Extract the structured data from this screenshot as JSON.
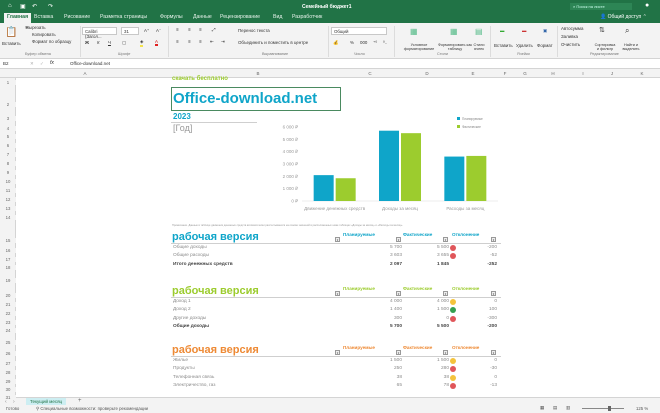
{
  "app": {
    "title": "Семейный бюджет1",
    "search_placeholder": "Поиск на листе",
    "share": "Общий доступ"
  },
  "colors": {
    "excel_green": "#217346",
    "blue": "#0fa5c9",
    "green": "#9ccc2e",
    "orange": "#ee8a35",
    "red_dot": "#e0565a",
    "yellow_dot": "#f4c33c",
    "green_dot": "#35a050"
  },
  "ribbon_tabs": [
    "Главная",
    "Вставка",
    "Рисование",
    "Разметка страницы",
    "Формулы",
    "Данные",
    "Рецензирование",
    "Вид",
    "Разработчик"
  ],
  "ribbon": {
    "paste": "Вставить",
    "cut": "Вырезать",
    "copy": "Копировать",
    "format_painter": "Формат по образцу",
    "clipboard_group": "Буфер обмена",
    "font_name": "Calibri (Загол...",
    "font_size": "31",
    "font_group": "Шрифт",
    "bold": "Ж",
    "italic": "К",
    "underline": "Ч",
    "wrap_text": "Перенос текста",
    "merge_center": "Объединить и поместить в центре",
    "alignment_group": "Выравнивание",
    "number_format": "Общий",
    "number_group": "Число",
    "percent": "%",
    "thousands": "000",
    "conditional": "Условное форматирование",
    "format_table": "Форматировать как таблицу",
    "cell_styles": "Стили ячеек",
    "styles_group": "Стили",
    "insert": "Вставить",
    "delete": "Удалить",
    "format": "Формат",
    "cells_group": "Ячейки",
    "autosum": "Автосумма",
    "fill": "Заливка",
    "clear": "Очистить",
    "sort_filter": "Сортировка и фильтр",
    "find_select": "Найти и выделить",
    "editing_group": "Редактирование"
  },
  "formula_bar": {
    "cell_ref": "B2",
    "fx": "fx",
    "value": "Office-download.net"
  },
  "columns": [
    "A",
    "B",
    "C",
    "D",
    "E",
    "F",
    "G",
    "H",
    "I",
    "J",
    "K"
  ],
  "rows": [
    "1",
    "2",
    "3",
    "4",
    "5",
    "6",
    "7",
    "8",
    "9",
    "10",
    "11",
    "12",
    "13",
    "14",
    "15",
    "16",
    "17",
    "18",
    "19",
    "20",
    "21",
    "22",
    "23",
    "24",
    "25",
    "26",
    "27",
    "28",
    "29",
    "30",
    "31"
  ],
  "sheet": {
    "download_free": "скачать бесплатно",
    "site": "Office-download.net",
    "year": "2023",
    "year_placeholder": "[Год]",
    "note": "Примечание. Данные в таблице движения денежных средств автоматически рассчитываются на основе значений в расположенных ниже таблицах «Доходы за месяц» и «Расходы за месяц»."
  },
  "chart_data": {
    "type": "bar",
    "categories": [
      "Движение денежных средств",
      "Доходы за месяц",
      "Расходы за месяц"
    ],
    "series": [
      {
        "name": "Планируемые",
        "values": [
          2097,
          5700,
          3603
        ],
        "color": "#0fa5c9"
      },
      {
        "name": "Фактические",
        "values": [
          1845,
          5500,
          3655
        ],
        "color": "#9ccc2e"
      }
    ],
    "yticks": [
      "0 ₽",
      "1 000 ₽",
      "2 000 ₽",
      "3 000 ₽",
      "4 000 ₽",
      "5 000 ₽",
      "6 000 ₽"
    ],
    "ylim": [
      0,
      6000
    ],
    "legend": "top-right",
    "grid": false
  },
  "tables": [
    {
      "title": "рабочая версия",
      "color": "#0fa5c9",
      "headers": [
        "Планируемые",
        "Фактические",
        "Отклонение"
      ],
      "rows": [
        {
          "label": "Общие доходы",
          "plan": "5 700",
          "fact": "5 500",
          "diff": "-200",
          "dot": "red"
        },
        {
          "label": "Общие расходы",
          "plan": "3 603",
          "fact": "3 655",
          "diff": "-52",
          "dot": "red"
        }
      ],
      "total": {
        "label": "Итого денежных средств",
        "plan": "2 097",
        "fact": "1 845",
        "diff": "-252"
      }
    },
    {
      "title": "рабочая версия",
      "color": "#9ccc2e",
      "headers": [
        "Планируемые",
        "Фактические",
        "Отклонение"
      ],
      "rows": [
        {
          "label": "Доход 1",
          "plan": "4 000",
          "fact": "4 000",
          "diff": "0",
          "dot": "yellow"
        },
        {
          "label": "Доход 2",
          "plan": "1 400",
          "fact": "1 500",
          "diff": "100",
          "dot": "green"
        },
        {
          "label": "Другие доходы",
          "plan": "300",
          "fact": "0",
          "diff": "-300",
          "dot": "red"
        }
      ],
      "total": {
        "label": "Общие доходы",
        "plan": "5 700",
        "fact": "5 500",
        "diff": "-200"
      }
    },
    {
      "title": "рабочая версия",
      "color": "#ee8a35",
      "headers": [
        "Планируемые",
        "Фактические",
        "Отклонение"
      ],
      "rows": [
        {
          "label": "Жилье",
          "plan": "1 500",
          "fact": "1 500",
          "diff": "0",
          "dot": "yellow"
        },
        {
          "label": "Продукты",
          "plan": "250",
          "fact": "280",
          "diff": "-30",
          "dot": "red"
        },
        {
          "label": "Телефонная связь",
          "plan": "38",
          "fact": "38",
          "diff": "0",
          "dot": "yellow"
        },
        {
          "label": "Электричество, газ",
          "plan": "65",
          "fact": "78",
          "diff": "-13",
          "dot": "red"
        }
      ]
    }
  ],
  "sheet_tabs": [
    "Текущий месяц"
  ],
  "status": {
    "ready": "Готово",
    "accessibility": "Специальные возможности: проверьте рекомендации",
    "zoom": "125 %"
  }
}
